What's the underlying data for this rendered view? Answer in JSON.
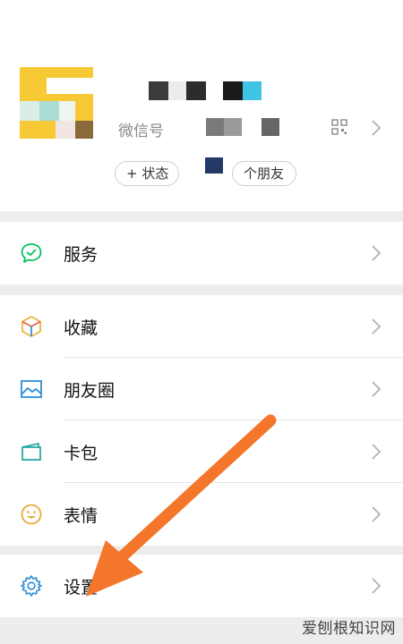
{
  "profile": {
    "wechat_id_label": "微信号",
    "status_button": "+ 状态",
    "friends_button": "个朋友"
  },
  "menu": {
    "services": "服务",
    "favorites": "收藏",
    "moments": "朋友圈",
    "cards": "卡包",
    "stickers": "表情",
    "settings": "设置"
  },
  "watermark": "爱刨根知识网",
  "colors": {
    "page_bg": "#ededed",
    "accent_green": "#07c160",
    "arrow_orange": "#f3762a"
  }
}
